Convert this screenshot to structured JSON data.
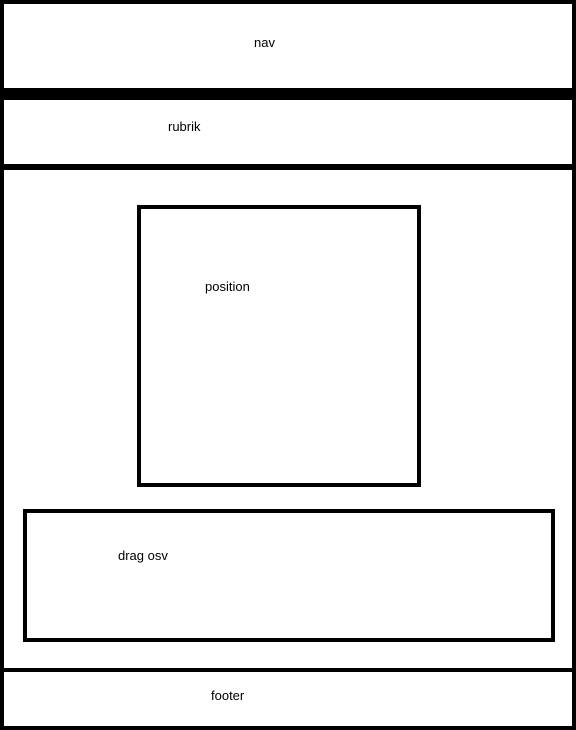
{
  "nav": {
    "label": "nav"
  },
  "rubrik": {
    "label": "rubrik"
  },
  "content": {
    "position": {
      "label": "position"
    },
    "drag": {
      "label": "drag osv"
    }
  },
  "footer": {
    "label": "footer"
  },
  "colors": {
    "border": "#000000",
    "background": "#ffffff"
  }
}
